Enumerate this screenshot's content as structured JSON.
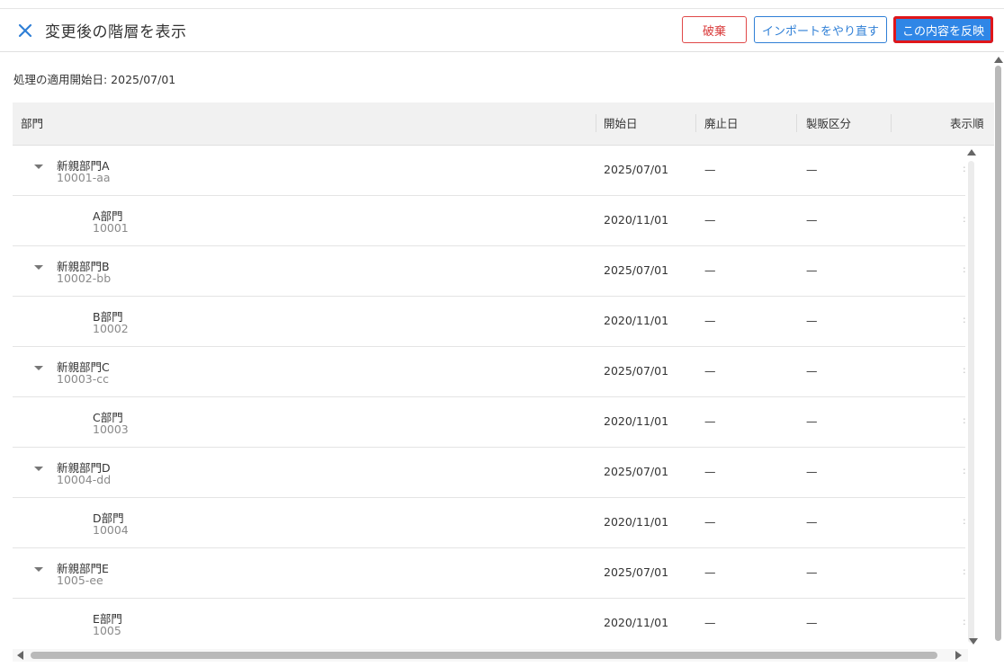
{
  "header": {
    "title": "変更後の階層を表示",
    "close_icon": "close-icon",
    "discard_label": "破棄",
    "reimport_label": "インポートをやり直す",
    "apply_label": "この内容を反映"
  },
  "effective_date_text": "処理の適用開始日: 2025/07/01",
  "table": {
    "columns": [
      "部門",
      "開始日",
      "廃止日",
      "製販区分",
      "表示順"
    ],
    "rows": [
      {
        "name": "新親部門A",
        "code": "10001-aa",
        "start": "2025/07/01",
        "end": "—",
        "kbn": "—",
        "order": ":"
      },
      {
        "name": "A部門",
        "code": "10001",
        "start": "2020/11/01",
        "end": "—",
        "kbn": "—",
        "order": ":"
      },
      {
        "name": "新親部門B",
        "code": "10002-bb",
        "start": "2025/07/01",
        "end": "—",
        "kbn": "—",
        "order": ":"
      },
      {
        "name": "B部門",
        "code": "10002",
        "start": "2020/11/01",
        "end": "—",
        "kbn": "—",
        "order": ":"
      },
      {
        "name": "新親部門C",
        "code": "10003-cc",
        "start": "2025/07/01",
        "end": "—",
        "kbn": "—",
        "order": ":"
      },
      {
        "name": "C部門",
        "code": "10003",
        "start": "2020/11/01",
        "end": "—",
        "kbn": "—",
        "order": ":"
      },
      {
        "name": "新親部門D",
        "code": "10004-dd",
        "start": "2025/07/01",
        "end": "—",
        "kbn": "—",
        "order": ":"
      },
      {
        "name": "D部門",
        "code": "10004",
        "start": "2020/11/01",
        "end": "—",
        "kbn": "—",
        "order": ":"
      },
      {
        "name": "新親部門E",
        "code": "1005-ee",
        "start": "2025/07/01",
        "end": "—",
        "kbn": "—",
        "order": ":"
      },
      {
        "name": "E部門",
        "code": "1005",
        "start": "2020/11/01",
        "end": "—",
        "kbn": "—",
        "order": ":"
      }
    ]
  },
  "colors": {
    "accent": "#2f86e6",
    "danger": "#e04848",
    "highlight": "#e0161a"
  }
}
